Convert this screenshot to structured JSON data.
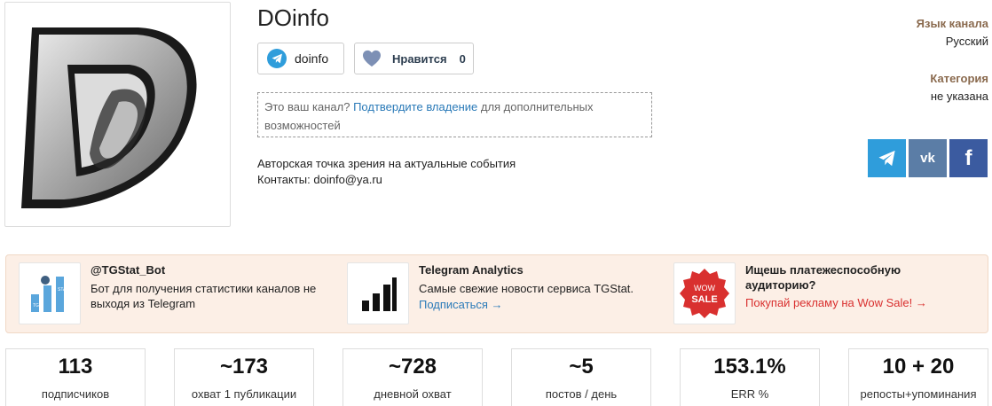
{
  "channel": {
    "title": "DOinfo",
    "handle": "doinfo",
    "like_label": "Нравится",
    "like_count": "0",
    "description": [
      "Авторская точка зрения на актуальные события",
      "Контакты: doinfo@ya.ru"
    ]
  },
  "claim": {
    "prefix": "Это ваш канал?",
    "link": "Подтвердите владение",
    "suffix": "для дополнительных возможностей"
  },
  "meta": {
    "language_label": "Язык канала",
    "language_value": "Русский",
    "category_label": "Категория",
    "category_value": "не указана"
  },
  "share": {
    "vk": "vk",
    "fb": "f"
  },
  "promos": [
    {
      "title": "@TGStat_Bot",
      "text": "Бот для получения статистики каналов не выходя из Telegram",
      "link": ""
    },
    {
      "title": "Telegram Analytics",
      "text": "Самые свежие новости сервиса TGStat.",
      "link": "Подписаться →"
    },
    {
      "title": "Ищешь платежеспособную аудиторию?",
      "text": "",
      "link": "Покупай рекламу на Wow Sale! →"
    }
  ],
  "promo_icons": {
    "wow": "WOW",
    "sale": "SALE",
    "tg": "TG",
    "stat": "STAT"
  },
  "stats": [
    {
      "value": "113",
      "label": "подписчиков"
    },
    {
      "value": "~173",
      "label": "охват 1 публикации"
    },
    {
      "value": "~728",
      "label": "дневной охват"
    },
    {
      "value": "~5",
      "label": "постов / день"
    },
    {
      "value": "153.1%",
      "label": "ERR %"
    },
    {
      "value": "10 + 20",
      "label": "репосты+упоминания"
    }
  ],
  "colors": {
    "telegram": "#2f9ddb",
    "vk": "#5b7da6",
    "facebook": "#3b5ba0",
    "link": "#2a7ab8",
    "promo_bg": "#fcefe6"
  }
}
